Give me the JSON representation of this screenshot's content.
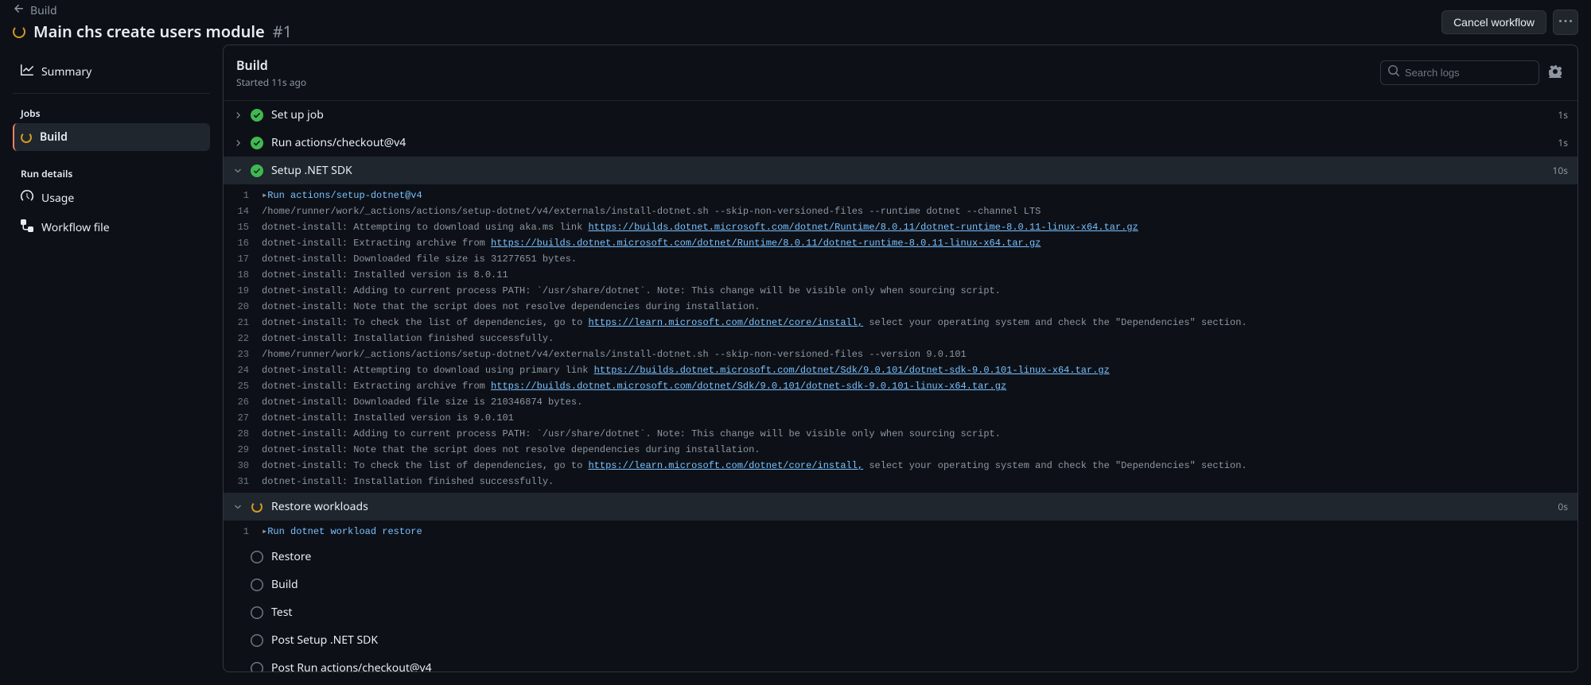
{
  "header": {
    "back_label": "Build",
    "title": "Main chs create users module",
    "run_number": "#1",
    "cancel_label": "Cancel workflow"
  },
  "sidebar": {
    "summary_label": "Summary",
    "jobs_heading": "Jobs",
    "jobs": [
      {
        "label": "Build"
      }
    ],
    "details_heading": "Run details",
    "details": [
      {
        "label": "Usage",
        "icon": "graph-icon"
      },
      {
        "label": "Workflow file",
        "icon": "workflow-icon"
      }
    ]
  },
  "log": {
    "title": "Build",
    "subtitle": "Started 11s ago",
    "search_placeholder": "Search logs",
    "steps": [
      {
        "name": "Set up job",
        "status": "success",
        "time": "1s",
        "expanded": false
      },
      {
        "name": "Run actions/checkout@v4",
        "status": "success",
        "time": "1s",
        "expanded": false
      },
      {
        "name": "Setup .NET SDK",
        "status": "success",
        "time": "10s",
        "expanded": true,
        "highlighted": true
      },
      {
        "name": "Restore workloads",
        "status": "running",
        "time": "0s",
        "expanded": true,
        "highlighted": true
      },
      {
        "name": "Restore",
        "status": "pending",
        "time": "",
        "expanded": false
      },
      {
        "name": "Build",
        "status": "pending",
        "time": "",
        "expanded": false
      },
      {
        "name": "Test",
        "status": "pending",
        "time": "",
        "expanded": false
      },
      {
        "name": "Post Setup .NET SDK",
        "status": "pending",
        "time": "",
        "expanded": false
      },
      {
        "name": "Post Run actions/checkout@v4",
        "status": "pending",
        "time": "",
        "expanded": false
      }
    ],
    "setup_lines": [
      {
        "n": "1",
        "marker": "▸",
        "cmd": "Run actions/setup-dotnet@v4"
      },
      {
        "n": "14",
        "text": "/home/runner/work/_actions/actions/setup-dotnet/v4/externals/install-dotnet.sh --skip-non-versioned-files --runtime dotnet --channel LTS"
      },
      {
        "n": "15",
        "prefix": "dotnet-install: Attempting to download using aka.ms link ",
        "link": "https://builds.dotnet.microsoft.com/dotnet/Runtime/8.0.11/dotnet-runtime-8.0.11-linux-x64.tar.gz"
      },
      {
        "n": "16",
        "prefix": "dotnet-install: Extracting archive from ",
        "link": "https://builds.dotnet.microsoft.com/dotnet/Runtime/8.0.11/dotnet-runtime-8.0.11-linux-x64.tar.gz"
      },
      {
        "n": "17",
        "text": "dotnet-install: Downloaded file size is 31277651 bytes."
      },
      {
        "n": "18",
        "text": "dotnet-install: Installed version is 8.0.11"
      },
      {
        "n": "19",
        "text": "dotnet-install: Adding to current process PATH: `/usr/share/dotnet`. Note: This change will be visible only when sourcing script."
      },
      {
        "n": "20",
        "text": "dotnet-install: Note that the script does not resolve dependencies during installation."
      },
      {
        "n": "21",
        "prefix": "dotnet-install: To check the list of dependencies, go to ",
        "link": "https://learn.microsoft.com/dotnet/core/install,",
        "suffix": " select your operating system and check the \"Dependencies\" section."
      },
      {
        "n": "22",
        "text": "dotnet-install: Installation finished successfully."
      },
      {
        "n": "23",
        "text": "/home/runner/work/_actions/actions/setup-dotnet/v4/externals/install-dotnet.sh --skip-non-versioned-files --version 9.0.101"
      },
      {
        "n": "24",
        "prefix": "dotnet-install: Attempting to download using primary link ",
        "link": "https://builds.dotnet.microsoft.com/dotnet/Sdk/9.0.101/dotnet-sdk-9.0.101-linux-x64.tar.gz"
      },
      {
        "n": "25",
        "prefix": "dotnet-install: Extracting archive from ",
        "link": "https://builds.dotnet.microsoft.com/dotnet/Sdk/9.0.101/dotnet-sdk-9.0.101-linux-x64.tar.gz"
      },
      {
        "n": "26",
        "text": "dotnet-install: Downloaded file size is 210346874 bytes."
      },
      {
        "n": "27",
        "text": "dotnet-install: Installed version is 9.0.101"
      },
      {
        "n": "28",
        "text": "dotnet-install: Adding to current process PATH: `/usr/share/dotnet`. Note: This change will be visible only when sourcing script."
      },
      {
        "n": "29",
        "text": "dotnet-install: Note that the script does not resolve dependencies during installation."
      },
      {
        "n": "30",
        "prefix": "dotnet-install: To check the list of dependencies, go to ",
        "link": "https://learn.microsoft.com/dotnet/core/install,",
        "suffix": " select your operating system and check the \"Dependencies\" section."
      },
      {
        "n": "31",
        "text": "dotnet-install: Installation finished successfully."
      }
    ],
    "restore_lines": [
      {
        "n": "1",
        "marker": "▸",
        "cmd": "Run dotnet workload restore"
      }
    ]
  }
}
